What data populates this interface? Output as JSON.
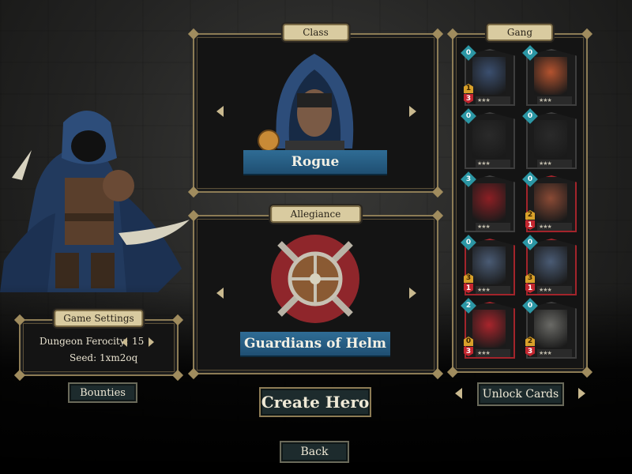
{
  "class_panel": {
    "tab": "Class",
    "name": "Rogue"
  },
  "allegiance_panel": {
    "tab": "Allegiance",
    "name": "Guardians of Helm"
  },
  "gang_panel": {
    "tab": "Gang",
    "cards": [
      {
        "cost": "0",
        "attack": "1",
        "health": "3",
        "frame": "neutral",
        "art": "hooded-bandit"
      },
      {
        "cost": "0",
        "attack": "",
        "health": "",
        "frame": "neutral",
        "art": "slash-card"
      },
      {
        "cost": "0",
        "attack": "",
        "health": "",
        "frame": "neutral",
        "art": "all-seeing-eye"
      },
      {
        "cost": "0",
        "attack": "",
        "health": "",
        "frame": "neutral",
        "art": "crossed-daggers"
      },
      {
        "cost": "3",
        "attack": "",
        "health": "",
        "frame": "neutral",
        "art": "red-claw"
      },
      {
        "cost": "0",
        "attack": "2",
        "health": "1",
        "frame": "red",
        "art": "red-haired-woman"
      },
      {
        "cost": "0",
        "attack": "3",
        "health": "1",
        "frame": "red",
        "art": "young-soldier"
      },
      {
        "cost": "0",
        "attack": "3",
        "health": "1",
        "frame": "red",
        "art": "young-soldier"
      },
      {
        "cost": "2",
        "attack": "0",
        "health": "3",
        "frame": "red",
        "art": "banner-tower"
      },
      {
        "cost": "0",
        "attack": "2",
        "health": "3",
        "frame": "neutral",
        "art": "armored-knight"
      }
    ]
  },
  "game_settings": {
    "tab": "Game Settings",
    "ferocity_label": "Dungeon Ferocity:",
    "ferocity_value": "15",
    "seed_label": "Seed: 1xm2oq"
  },
  "buttons": {
    "bounties": "Bounties",
    "create_hero": "Create Hero",
    "unlock_cards": "Unlock Cards",
    "back": "Back"
  },
  "colors": {
    "panel_border": "#8d7c55",
    "tab_parchment": "#d9cba0",
    "banner_blue": "#2f6c95",
    "gem_teal": "#2b96a4",
    "health_red": "#c3262f",
    "attack_gold": "#d9a12a"
  }
}
